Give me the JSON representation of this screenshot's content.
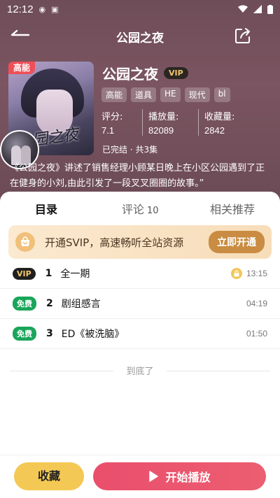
{
  "status_bar": {
    "time": "12:12"
  },
  "nav": {
    "title": "公园之夜"
  },
  "cover": {
    "art_text": "公园之夜",
    "hot_label": "高能"
  },
  "book": {
    "title": "公园之夜",
    "vip_label": "VIP",
    "tags": [
      "高能",
      "道具",
      "HE",
      "现代",
      "bl"
    ],
    "stats": {
      "rating_label": "评分:",
      "rating_value": "7.1",
      "plays_label": "播放量:",
      "plays_value": "82089",
      "favs_label": "收藏量:",
      "favs_value": "2842"
    },
    "status": "已完结 · 共3集",
    "description": "《公园之夜》讲述了销售经理小顾某日晚上在小区公园遇到了正在健身的小刘,由此引发了一段叉叉圈圈的故事。”"
  },
  "tabs": {
    "contents": "目录",
    "comments": "评论",
    "comments_count": "10",
    "recommendations": "相关推荐"
  },
  "vip_banner": {
    "text": "开通SVIP，高速畅听全站资源",
    "button": "立即开通"
  },
  "episodes": [
    {
      "badge": "VIP",
      "badge_type": "vip",
      "num": "1",
      "title": "全一期",
      "locked": true,
      "duration": "13:15"
    },
    {
      "badge": "免费",
      "badge_type": "free",
      "num": "2",
      "title": "剧组感言",
      "locked": false,
      "duration": "04:19"
    },
    {
      "badge": "免费",
      "badge_type": "free",
      "num": "3",
      "title": "ED《被洗脑》",
      "locked": false,
      "duration": "01:50"
    }
  ],
  "end_text": "到底了",
  "bottom": {
    "favorite": "收藏",
    "play": "开始播放"
  },
  "colors": {
    "accent": "#e94e68",
    "vip_gold": "#f0c76b",
    "free_green": "#1aa55a",
    "fav_yellow": "#f4c854"
  }
}
